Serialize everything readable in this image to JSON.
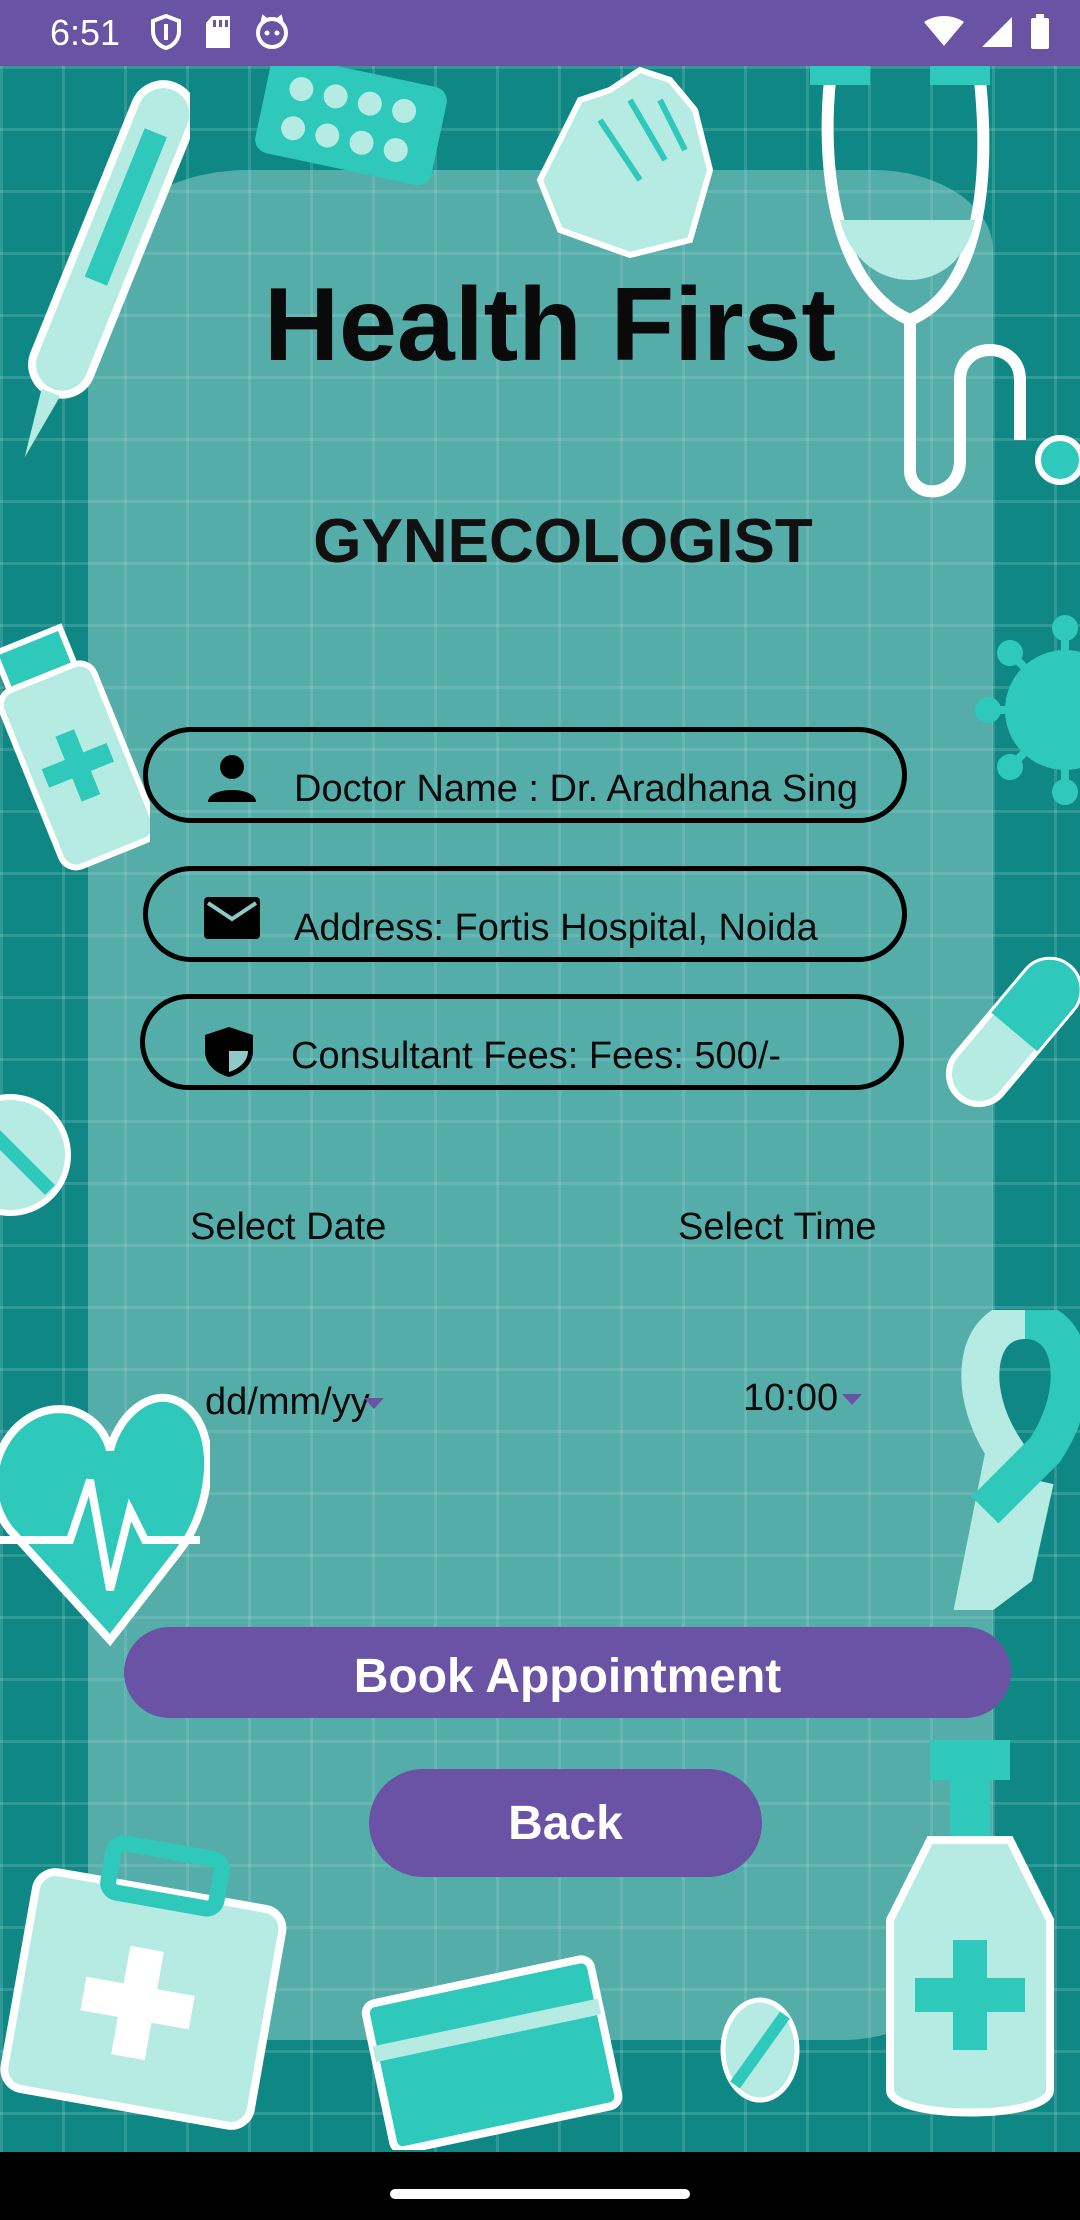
{
  "status_bar": {
    "time": "6:51",
    "left_icons": [
      "shield-icon",
      "sd-card-icon",
      "cat-icon"
    ],
    "right_icons": [
      "wifi-icon",
      "signal-icon",
      "battery-icon"
    ]
  },
  "header": {
    "title": "Health First",
    "specialty": "GYNECOLOGIST"
  },
  "details": {
    "doctor": {
      "icon": "person-icon",
      "text": "Doctor Name : Dr. Aradhana Sing"
    },
    "address": {
      "icon": "mail-icon",
      "text": "Address: Fortis Hospital, Noida"
    },
    "fees": {
      "icon": "shield-icon",
      "text": "Consultant Fees: Fees: 500/-"
    }
  },
  "booking": {
    "date_label": "Select Date",
    "time_label": "Select Time",
    "date_value": "dd/mm/yy",
    "time_value": "10:00"
  },
  "actions": {
    "book_label": "Book Appointment",
    "back_label": "Back"
  },
  "colors": {
    "accent": "#6a52a4",
    "background": "#0f8784",
    "mint": "#2ec9bb"
  }
}
